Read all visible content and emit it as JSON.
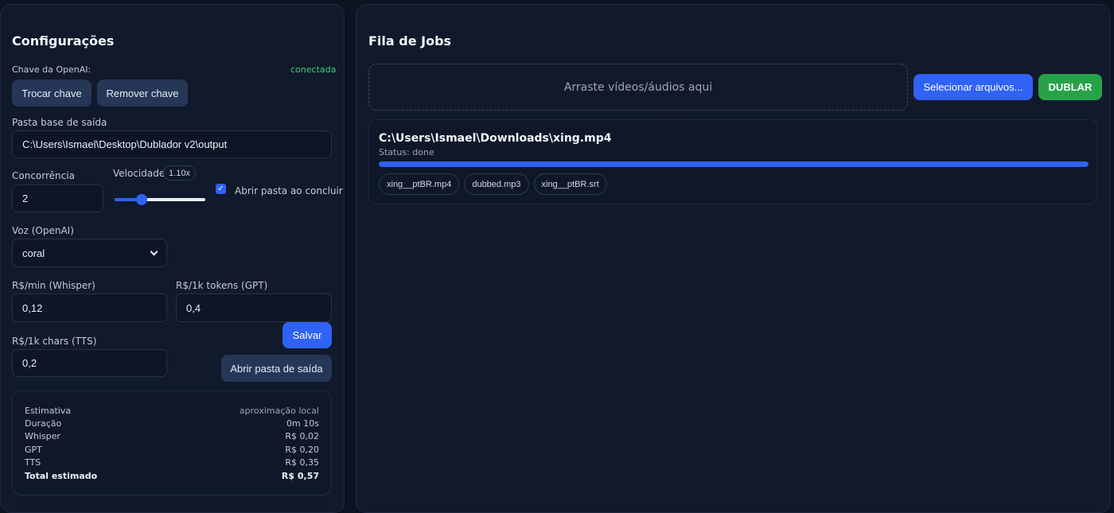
{
  "config": {
    "title": "Configurações",
    "api_key": {
      "label": "Chave da OpenAI:",
      "status": "conectada",
      "change_label": "Trocar chave",
      "remove_label": "Remover chave"
    },
    "output_dir": {
      "label": "Pasta base de saída",
      "value": "C:\\Users\\Ismael\\Desktop\\Dublador v2\\output"
    },
    "concurrency": {
      "label": "Concorrência",
      "value": "2"
    },
    "speed": {
      "label": "Velocidade",
      "badge": "1.10x",
      "level": 0.3
    },
    "open_folder": {
      "label": "Abrir pasta ao concluir",
      "checked": true
    },
    "voice": {
      "label": "Voz (OpenAI)",
      "value": "coral"
    },
    "price_whisper": {
      "label": "R$/min (Whisper)",
      "value": "0,12"
    },
    "price_gpt": {
      "label": "R$/1k tokens (GPT)",
      "value": "0,4"
    },
    "price_tts": {
      "label": "R$/1k chars (TTS)",
      "value": "0,2"
    },
    "save_label": "Salvar",
    "open_output_label": "Abrir pasta de saída",
    "estimate": {
      "title": "Estimativa",
      "note": "aproximação local",
      "rows": [
        {
          "label": "Duração",
          "value": "0m 10s"
        },
        {
          "label": "Whisper",
          "value": "R$ 0,02"
        },
        {
          "label": "GPT",
          "value": "R$ 0,20"
        },
        {
          "label": "TTS",
          "value": "R$ 0,35"
        }
      ],
      "total": {
        "label": "Total estimado",
        "value": "R$ 0,57"
      }
    }
  },
  "jobs": {
    "title": "Fila de Jobs",
    "dropzone_text": "Arraste vídeos/áudios aqui",
    "select_label": "Selecionar arquivos...",
    "dub_label": "DUBLAR",
    "items": [
      {
        "path": "C:\\Users\\Ismael\\Downloads\\xing.mp4",
        "status": "Status: done",
        "progress": 1.0,
        "outputs": [
          "xing__ptBR.mp4",
          "dubbed.mp3",
          "xing__ptBR.srt"
        ]
      }
    ]
  },
  "colors": {
    "accent": "#2f62f5",
    "success": "#26a348",
    "connected": "#3ecf6e",
    "panel": "#111a2b",
    "background": "#0b1220"
  }
}
